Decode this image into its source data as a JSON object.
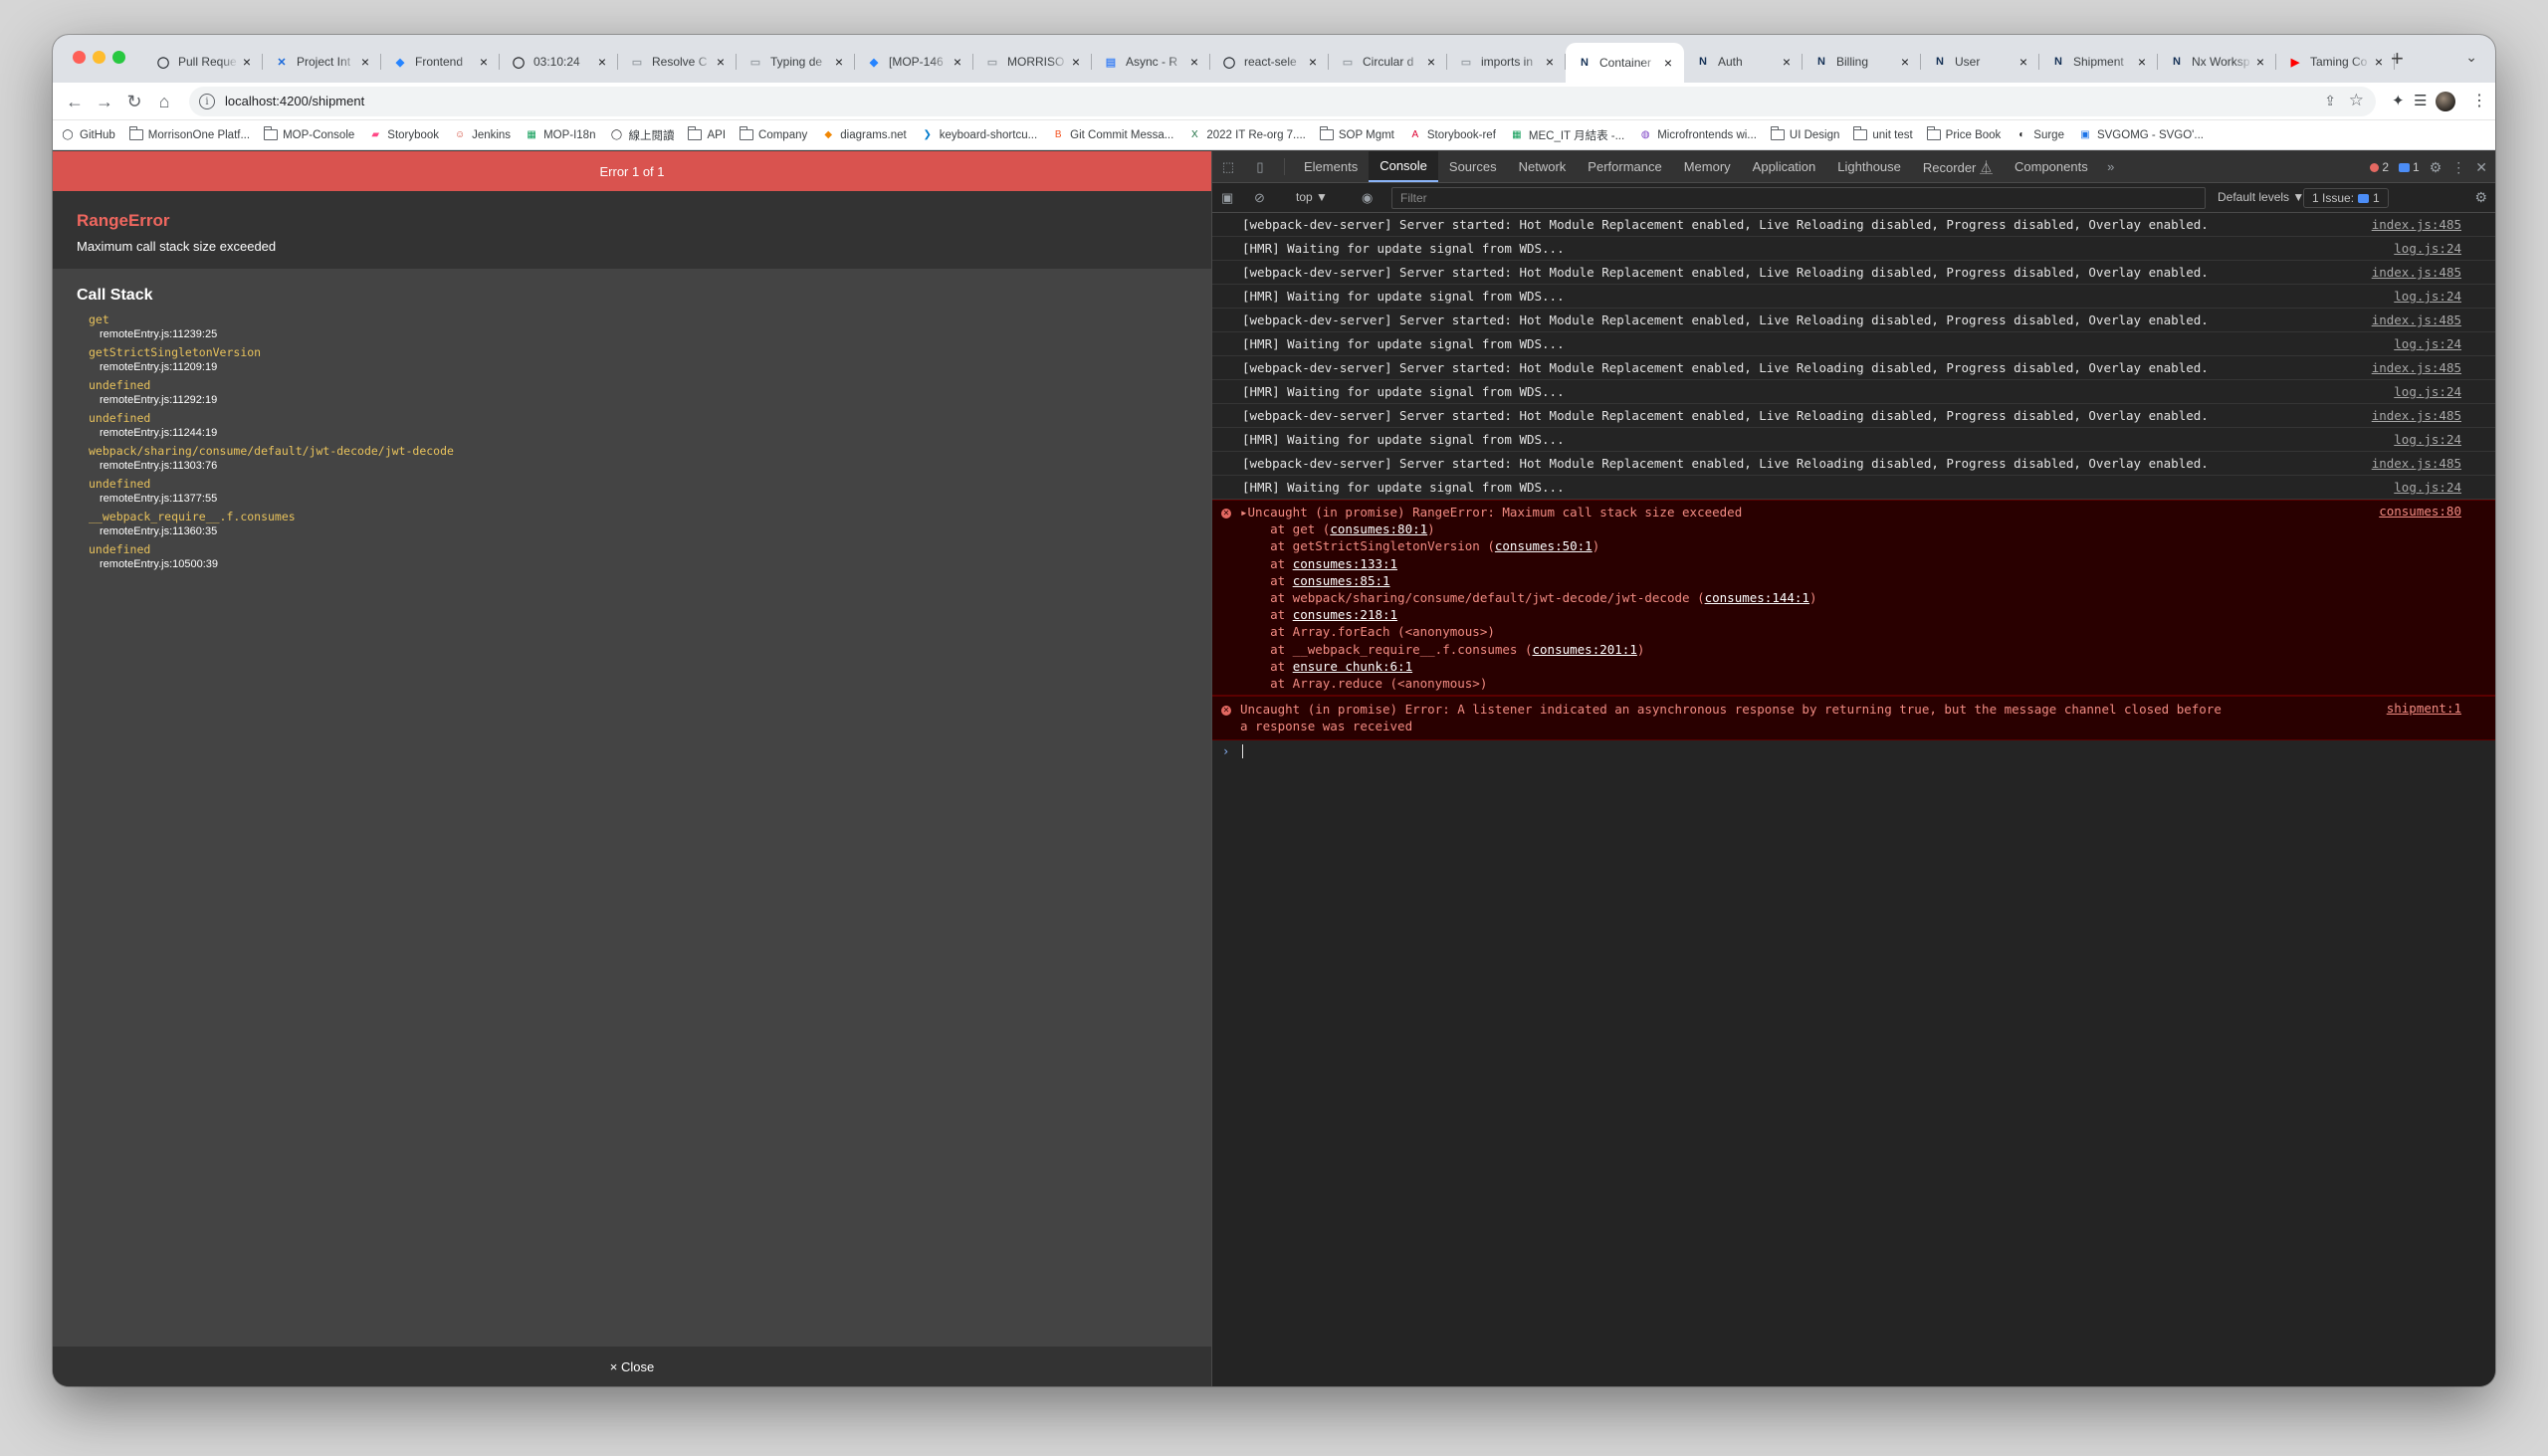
{
  "browser": {
    "tabs": [
      {
        "title": "Pull Reque",
        "icon": "github-icon",
        "active": false
      },
      {
        "title": "Project Int",
        "icon": "confluence-icon",
        "active": false
      },
      {
        "title": "Frontend",
        "icon": "jira-icon",
        "active": false
      },
      {
        "title": "03:10:24",
        "icon": "timer-icon",
        "active": false
      },
      {
        "title": "Resolve C",
        "icon": "page-icon",
        "active": false
      },
      {
        "title": "Typing de",
        "icon": "page-icon",
        "active": false
      },
      {
        "title": "[MOP-146",
        "icon": "jira-icon",
        "active": false
      },
      {
        "title": "MORRISO",
        "icon": "page-icon",
        "active": false
      },
      {
        "title": "Async - R",
        "icon": "doc-icon",
        "active": false
      },
      {
        "title": "react-sele",
        "icon": "github-icon",
        "active": false
      },
      {
        "title": "Circular d",
        "icon": "page-icon",
        "active": false
      },
      {
        "title": "imports in",
        "icon": "page-icon",
        "active": false
      },
      {
        "title": "Container",
        "icon": "nx-icon",
        "active": true
      },
      {
        "title": "Auth",
        "icon": "nx-icon",
        "active": false
      },
      {
        "title": "Billing",
        "icon": "nx-icon",
        "active": false
      },
      {
        "title": "User",
        "icon": "nx-icon",
        "active": false
      },
      {
        "title": "Shipment",
        "icon": "nx-icon",
        "active": false
      },
      {
        "title": "Nx Worksp",
        "icon": "nx-icon",
        "active": false
      },
      {
        "title": "Taming Co",
        "icon": "youtube-icon",
        "active": false
      }
    ],
    "url": "localhost:4200/shipment",
    "bookmarks": [
      {
        "label": "GitHub",
        "icon": "github-icon"
      },
      {
        "label": "MorrisonOne Platf...",
        "icon": "folder-icon"
      },
      {
        "label": "MOP-Console",
        "icon": "folder-icon"
      },
      {
        "label": "Storybook",
        "icon": "storybook-icon"
      },
      {
        "label": "Jenkins",
        "icon": "jenkins-icon"
      },
      {
        "label": "MOP-I18n",
        "icon": "sheets-icon"
      },
      {
        "label": "線上閱讀",
        "icon": "circle-icon"
      },
      {
        "label": "API",
        "icon": "folder-icon"
      },
      {
        "label": "Company",
        "icon": "folder-icon"
      },
      {
        "label": "diagrams.net",
        "icon": "drawio-icon"
      },
      {
        "label": "keyboard-shortcu...",
        "icon": "vscode-icon"
      },
      {
        "label": "Git Commit Messa...",
        "icon": "blogger-icon"
      },
      {
        "label": "2022 IT Re-org 7....",
        "icon": "excel-icon"
      },
      {
        "label": "SOP Mgmt",
        "icon": "folder-icon"
      },
      {
        "label": "Storybook-ref",
        "icon": "angular-icon"
      },
      {
        "label": "MEC_IT 月結表 -...",
        "icon": "sheets-icon"
      },
      {
        "label": "Microfrontends wi...",
        "icon": "purple-icon"
      },
      {
        "label": "UI Design",
        "icon": "folder-icon"
      },
      {
        "label": "unit test",
        "icon": "folder-icon"
      },
      {
        "label": "Price Book",
        "icon": "folder-icon"
      },
      {
        "label": "Surge",
        "icon": "surge-icon"
      },
      {
        "label": "SVGOMG - SVGO'...",
        "icon": "svgomg-icon"
      }
    ]
  },
  "overlay": {
    "header": "Error 1 of 1",
    "error_name": "RangeError",
    "error_message": "Maximum call stack size exceeded",
    "callstack_title": "Call Stack",
    "frames": [
      {
        "fn": "get",
        "loc": "remoteEntry.js:11239:25"
      },
      {
        "fn": "getStrictSingletonVersion",
        "loc": "remoteEntry.js:11209:19"
      },
      {
        "fn": "undefined",
        "loc": "remoteEntry.js:11292:19"
      },
      {
        "fn": "undefined",
        "loc": "remoteEntry.js:11244:19"
      },
      {
        "fn": "webpack/sharing/consume/default/jwt-decode/jwt-decode",
        "loc": "remoteEntry.js:11303:76"
      },
      {
        "fn": "undefined",
        "loc": "remoteEntry.js:11377:55"
      },
      {
        "fn": "__webpack_require__.f.consumes",
        "loc": "remoteEntry.js:11360:35"
      },
      {
        "fn": "undefined",
        "loc": "remoteEntry.js:10500:39"
      }
    ],
    "close_label": "× Close"
  },
  "devtools": {
    "tabs": [
      "Elements",
      "Console",
      "Sources",
      "Network",
      "Performance",
      "Memory",
      "Application",
      "Lighthouse",
      "Recorder ⏅",
      "Components"
    ],
    "active_tab": "Console",
    "error_count": "2",
    "message_count": "1",
    "context": "top ▼",
    "filter_placeholder": "Filter",
    "levels": "Default levels ▼",
    "issues_label": "1 Issue:",
    "issues_count": "1",
    "logs": [
      {
        "text": "[webpack-dev-server] Server started: Hot Module Replacement enabled, Live Reloading disabled, Progress disabled, Overlay enabled.",
        "src": "index.js:485"
      },
      {
        "text": "[HMR] Waiting for update signal from WDS...",
        "src": "log.js:24"
      },
      {
        "text": "[webpack-dev-server] Server started: Hot Module Replacement enabled, Live Reloading disabled, Progress disabled, Overlay enabled.",
        "src": "index.js:485"
      },
      {
        "text": "[HMR] Waiting for update signal from WDS...",
        "src": "log.js:24"
      },
      {
        "text": "[webpack-dev-server] Server started: Hot Module Replacement enabled, Live Reloading disabled, Progress disabled, Overlay enabled.",
        "src": "index.js:485"
      },
      {
        "text": "[HMR] Waiting for update signal from WDS...",
        "src": "log.js:24"
      },
      {
        "text": "[webpack-dev-server] Server started: Hot Module Replacement enabled, Live Reloading disabled, Progress disabled, Overlay enabled.",
        "src": "index.js:485"
      },
      {
        "text": "[HMR] Waiting for update signal from WDS...",
        "src": "log.js:24"
      },
      {
        "text": "[webpack-dev-server] Server started: Hot Module Replacement enabled, Live Reloading disabled, Progress disabled, Overlay enabled.",
        "src": "index.js:485"
      },
      {
        "text": "[HMR] Waiting for update signal from WDS...",
        "src": "log.js:24"
      },
      {
        "text": "[webpack-dev-server] Server started: Hot Module Replacement enabled, Live Reloading disabled, Progress disabled, Overlay enabled.",
        "src": "index.js:485"
      },
      {
        "text": "[HMR] Waiting for update signal from WDS...",
        "src": "log.js:24"
      }
    ],
    "error1": {
      "headline": "▸Uncaught (in promise) RangeError: Maximum call stack size exceeded",
      "src": "consumes:80",
      "stack": [
        {
          "pre": "    at get (",
          "link": "consumes:80:1",
          "post": ")"
        },
        {
          "pre": "    at getStrictSingletonVersion (",
          "link": "consumes:50:1",
          "post": ")"
        },
        {
          "pre": "    at ",
          "link": "consumes:133:1",
          "post": ""
        },
        {
          "pre": "    at ",
          "link": "consumes:85:1",
          "post": ""
        },
        {
          "pre": "    at webpack/sharing/consume/default/jwt-decode/jwt-decode (",
          "link": "consumes:144:1",
          "post": ")"
        },
        {
          "pre": "    at ",
          "link": "consumes:218:1",
          "post": ""
        },
        {
          "pre": "    at Array.forEach (<anonymous>)",
          "link": "",
          "post": ""
        },
        {
          "pre": "    at __webpack_require__.f.consumes (",
          "link": "consumes:201:1",
          "post": ")"
        },
        {
          "pre": "    at ",
          "link": "ensure chunk:6:1",
          "post": ""
        },
        {
          "pre": "    at Array.reduce (<anonymous>)",
          "link": "",
          "post": ""
        }
      ]
    },
    "error2": {
      "line1": "Uncaught (in promise) Error: A listener indicated an asynchronous response by returning true, but the message channel closed before",
      "line2": "a response was received",
      "src": "shipment:1"
    },
    "prompt": "›"
  }
}
